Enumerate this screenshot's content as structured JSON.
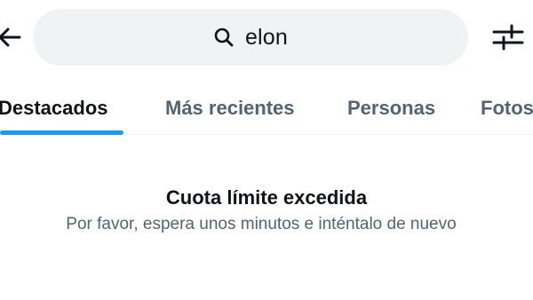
{
  "header": {
    "back_icon": "arrow-left-icon",
    "search": {
      "icon": "search-icon",
      "query": "elon"
    },
    "filter_icon": "sliders-icon"
  },
  "tabs": [
    {
      "label": "Destacados",
      "active": true
    },
    {
      "label": "Más recientes",
      "active": false
    },
    {
      "label": "Personas",
      "active": false
    },
    {
      "label": "Fotos",
      "active": false
    }
  ],
  "message": {
    "title": "Cuota límite excedida",
    "subtitle": "Por favor, espera unos minutos e inténtalo de nuevo"
  },
  "colors": {
    "accent": "#1d9bf0",
    "search_bg": "#eff3f4",
    "muted_text": "#536471",
    "primary_text": "#0f1419"
  }
}
